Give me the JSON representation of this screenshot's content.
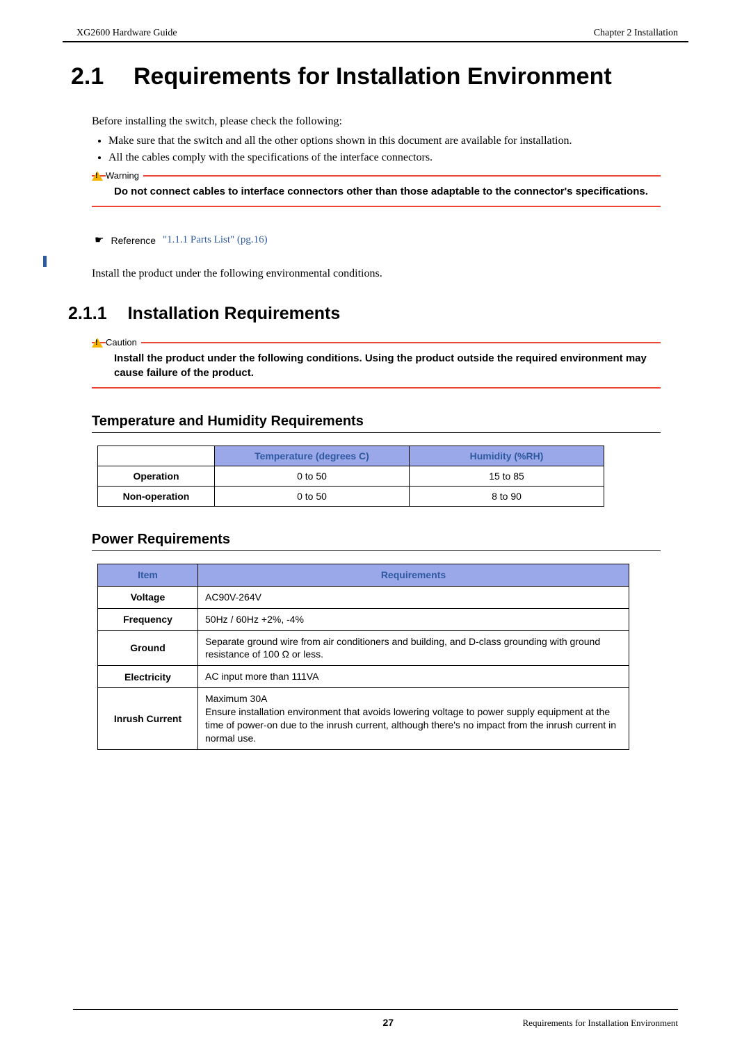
{
  "header": {
    "doc_title": "XG2600 Hardware Guide",
    "chapter": "Chapter 2 Installation"
  },
  "h1": {
    "num": "2.1",
    "title": "Requirements for Installation Environment"
  },
  "intro": "Before installing the switch, please check the following:",
  "bullets": [
    "Make sure that the switch and all the other options shown in this document are available for installation.",
    "All the cables comply with the specifications of the interface connectors."
  ],
  "warning": {
    "label": "Warning",
    "text": "Do not connect cables to interface connectors other than those adaptable to the connector's specifications."
  },
  "reference": {
    "label": "Reference",
    "link": "\"1.1.1 Parts List\" (pg.16)"
  },
  "para2": "Install the product under the following environmental conditions.",
  "h2": {
    "num": "2.1.1",
    "title": "Installation Requirements"
  },
  "caution": {
    "label": "Caution",
    "text": "Install the product under the following conditions. Using the product outside the required environment may cause failure of the product."
  },
  "h3a": "Temperature and Humidity Requirements",
  "table1": {
    "headers": [
      "",
      "Temperature (degrees C)",
      "Humidity (%RH)"
    ],
    "rows": [
      {
        "label": "Operation",
        "temp": "0 to 50",
        "humidity": "15 to 85"
      },
      {
        "label": "Non-operation",
        "temp": "0 to 50",
        "humidity": "8 to 90"
      }
    ]
  },
  "h3b": "Power Requirements",
  "table2": {
    "headers": [
      "Item",
      "Requirements"
    ],
    "rows": [
      {
        "item": "Voltage",
        "req": "AC90V-264V"
      },
      {
        "item": "Frequency",
        "req": "50Hz / 60Hz   +2%, -4%"
      },
      {
        "item": "Ground",
        "req": "Separate ground wire from air conditioners and building, and D-class grounding with ground resistance of 100 Ω or less."
      },
      {
        "item": "Electricity",
        "req": "AC input more than 111VA"
      },
      {
        "item": "Inrush Current",
        "req": "Maximum 30A\nEnsure installation environment that avoids lowering voltage to power supply equipment at the time of power-on due to the inrush current, although there's no impact from the inrush current in normal use."
      }
    ]
  },
  "footer": {
    "page": "27",
    "title": "Requirements for Installation Environment"
  }
}
